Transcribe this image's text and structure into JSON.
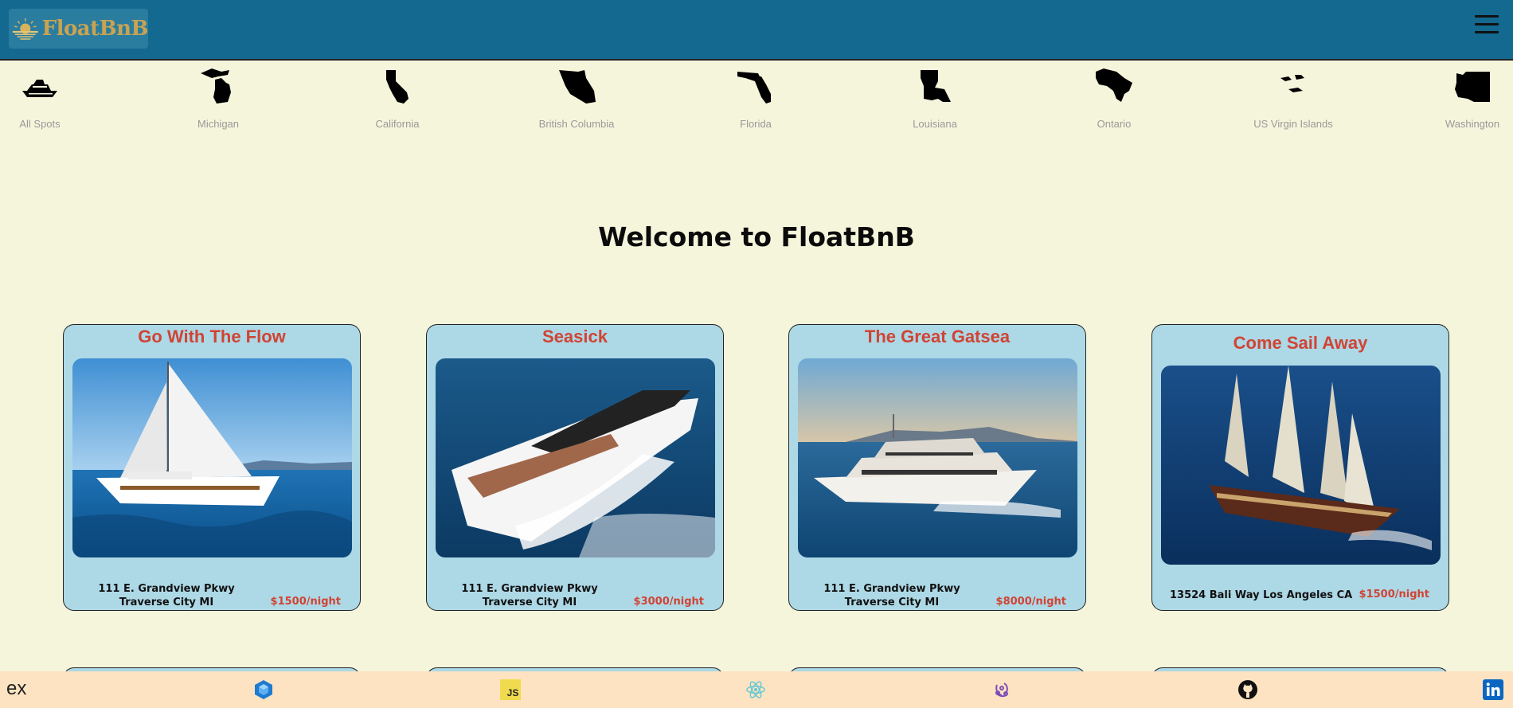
{
  "header": {
    "logo_text": "FloatBnB",
    "menu_icon": "hamburger-menu-icon"
  },
  "categories": [
    {
      "label": "All Spots",
      "icon": "yacht-icon"
    },
    {
      "label": "Michigan",
      "icon": "michigan-map-icon"
    },
    {
      "label": "California",
      "icon": "california-map-icon"
    },
    {
      "label": "British Columbia",
      "icon": "british-columbia-map-icon"
    },
    {
      "label": "Florida",
      "icon": "florida-map-icon"
    },
    {
      "label": "Louisiana",
      "icon": "louisiana-map-icon"
    },
    {
      "label": "Ontario",
      "icon": "ontario-map-icon"
    },
    {
      "label": "US Virgin Islands",
      "icon": "us-virgin-islands-map-icon"
    },
    {
      "label": "Washington",
      "icon": "washington-map-icon"
    }
  ],
  "main": {
    "welcome": "Welcome to FloatBnB"
  },
  "spots": [
    {
      "title": "Go With The Flow",
      "address": "111 E. Grandview Pkwy Traverse City MI",
      "price": "$1500/night",
      "image": "sailboat-photo"
    },
    {
      "title": "Seasick",
      "address": "111 E. Grandview Pkwy Traverse City MI",
      "price": "$3000/night",
      "image": "speedboat-photo"
    },
    {
      "title": "The Great Gatsea",
      "address": "111 E. Grandview Pkwy Traverse City MI",
      "price": "$8000/night",
      "image": "superyacht-photo"
    },
    {
      "title": "Come Sail Away",
      "address": "13524 Bali Way Los Angeles CA",
      "price": "$1500/night",
      "image": "schooner-photo"
    }
  ],
  "footer": {
    "ex_text": "ex",
    "icons": [
      "sequelize-icon",
      "javascript-icon",
      "react-icon",
      "redux-icon",
      "github-icon",
      "linkedin-icon"
    ],
    "js_text": "JS"
  },
  "colors": {
    "header": "#136990",
    "background": "#f5f5dc",
    "card": "#add8e6",
    "accent": "#d04434",
    "footer": "#fde3c1",
    "logo_gold": "#c9a352"
  }
}
